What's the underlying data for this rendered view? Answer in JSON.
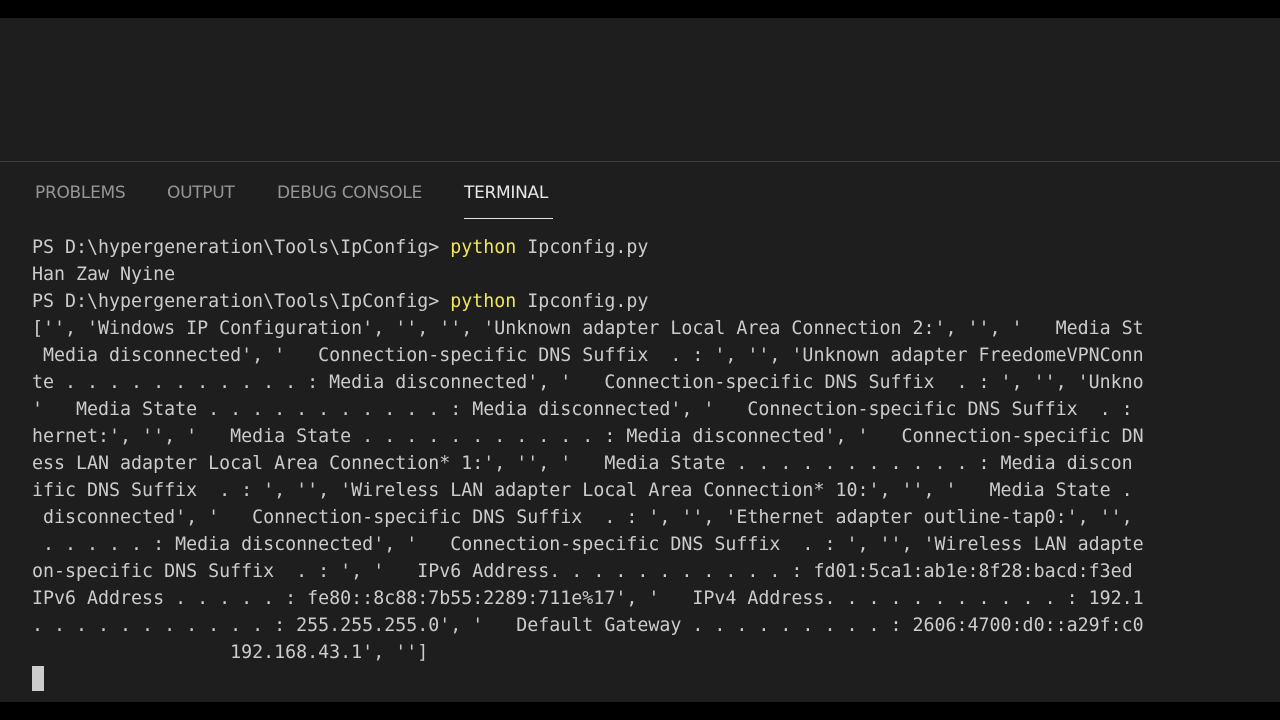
{
  "tabs": {
    "problems": "PROBLEMS",
    "output": "OUTPUT",
    "debug_console": "DEBUG CONSOLE",
    "terminal": "TERMINAL"
  },
  "terminal": {
    "prompt1": "PS D:\\hypergeneration\\Tools\\IpConfig> ",
    "cmd1": "python",
    "arg1": " Ipconfig.py",
    "output1": "Han Zaw Nyine",
    "prompt2": "PS D:\\hypergeneration\\Tools\\IpConfig> ",
    "cmd2": "python",
    "arg2": " Ipconfig.py",
    "output_lines": [
      "['', 'Windows IP Configuration', '', '', 'Unknown adapter Local Area Connection 2:', '', '   Media St",
      " Media disconnected', '   Connection-specific DNS Suffix  . : ', '', 'Unknown adapter FreedomeVPNConn",
      "te . . . . . . . . . . . : Media disconnected', '   Connection-specific DNS Suffix  . : ', '', 'Unkno",
      "'   Media State . . . . . . . . . . . : Media disconnected', '   Connection-specific DNS Suffix  . :",
      "hernet:', '', '   Media State . . . . . . . . . . . : Media disconnected', '   Connection-specific DN",
      "ess LAN adapter Local Area Connection* 1:', '', '   Media State . . . . . . . . . . . : Media discon",
      "ific DNS Suffix  . : ', '', 'Wireless LAN adapter Local Area Connection* 10:', '', '   Media State .",
      " disconnected', '   Connection-specific DNS Suffix  . : ', '', 'Ethernet adapter outline-tap0:', '',",
      " . . . . . : Media disconnected', '   Connection-specific DNS Suffix  . : ', '', 'Wireless LAN adapte",
      "on-specific DNS Suffix  . : ', '   IPv6 Address. . . . . . . . . . . : fd01:5ca1:ab1e:8f28:bacd:f3ed",
      "IPv6 Address . . . . . : fe80::8c88:7b55:2289:711e%17', '   IPv4 Address. . . . . . . . . . . : 192.1",
      ". . . . . . . . . . . : 255.255.255.0', '   Default Gateway . . . . . . . . . : 2606:4700:d0::a29f:c0",
      "                  192.168.43.1', '']"
    ]
  }
}
